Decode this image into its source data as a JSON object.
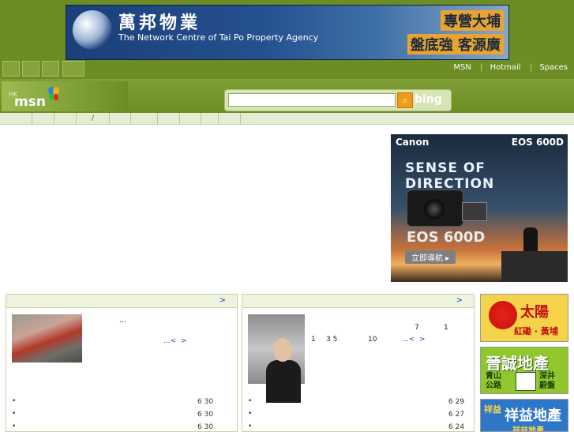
{
  "colors": {
    "header_green": "#6b8d23",
    "link_blue": "#1a4ca8",
    "nav_bg": "#e6ecd4",
    "search_button": "#f09a1a"
  },
  "banner": {
    "title_cn": "萬邦物業",
    "subtitle": "The Network Centre of Tai Po Property Agency",
    "tag1": "專營大埔",
    "tag2": "盤底強 客源廣"
  },
  "toplinks": {
    "msn": "MSN",
    "hotmail": "Hotmail",
    "spaces": "Spaces"
  },
  "logo": {
    "hk": "HK",
    "msn": "msn"
  },
  "search": {
    "placeholder": "",
    "value": "",
    "button_icon": "search-icon",
    "brand": "bing"
  },
  "nav": {
    "slash": "/"
  },
  "ad": {
    "brand": "Canon",
    "model": "EOS 600D",
    "tagline": "SENSE OF DIRECTION",
    "model_large": "EOS 600D",
    "cta": "立即導航 ▸"
  },
  "panel1": {
    "more": ">",
    "ellipsis": "...",
    "read_more": "...<",
    "read_more_arrow": ">",
    "dates": [
      "6 30",
      "6 30",
      "6 30"
    ]
  },
  "panel2": {
    "more": ">",
    "n7": "7",
    "n1": "1",
    "n1b": "1",
    "n35": "3 5",
    "n10": "10",
    "read_more": "...<",
    "read_more_arrow": ">",
    "dates": [
      "6 29",
      "6 27",
      "6 24"
    ]
  },
  "sidebar_ads": {
    "ad1": {
      "title": "太陽",
      "sub": "紅磡 · 黃埔"
    },
    "ad2": {
      "title": "晉誠地產",
      "left": "青山\n公路",
      "right": "深井\n蔚盤"
    },
    "ad3": {
      "prefix": "祥益",
      "title": "祥益地產",
      "sub": "祥益地產"
    }
  }
}
